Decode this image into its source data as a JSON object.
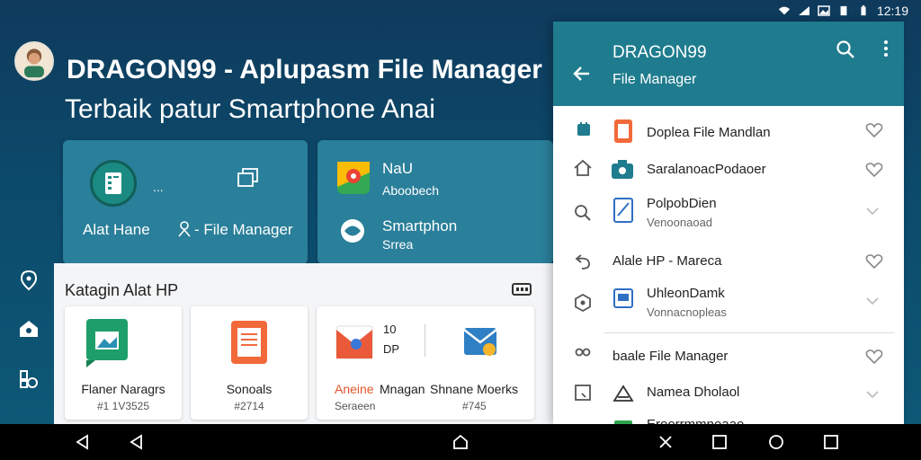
{
  "status_bar": {
    "time": "12:19",
    "icons": [
      "wifi-icon",
      "signal-icon",
      "image-icon",
      "sim-icon",
      "battery-icon"
    ]
  },
  "hero": {
    "title": "DRAGON99 - Aplupasm File Manager",
    "subtitle": "Terbaik patur Smartphone Anai"
  },
  "feature_cards": [
    {
      "label_left": "Alat Hane",
      "label_right": "- File Manager",
      "dots": "..."
    },
    {
      "item1_title": "NaU",
      "item1_sub": "Aboobech",
      "item2_title": "Smartphon",
      "item2_sub": "Srrea"
    }
  ],
  "left_rail": {
    "icons": [
      "location-pin-icon",
      "home-icon",
      "apps-icon"
    ]
  },
  "category_panel": {
    "title": "Katagin Alat HP",
    "cards": [
      {
        "title": "Flaner Naragrs",
        "num": "#1 1V3525"
      },
      {
        "title": "Sonoals",
        "num": "#2714"
      },
      {
        "title_a": "Aneine",
        "title_b": "Mnagan",
        "sub": "Seraeen",
        "num_left": "10",
        "num_left2": "DP",
        "title": "Shnane Moerks",
        "num": "#745"
      }
    ]
  },
  "drawer": {
    "title": "DRAGON99",
    "subtitle": "File Manager",
    "items": [
      {
        "label": "Doplea File Mandlan"
      },
      {
        "label": "SaralanoacPodaoer"
      },
      {
        "label": "PolpobDien",
        "sub": "Venoonaoad"
      },
      {
        "label": "Alale HP - Mareca"
      },
      {
        "label": "UhleonDamk",
        "sub": "Vonnacnopleas"
      },
      {
        "label": "baale File Manager"
      },
      {
        "label": "Namea Dholaol"
      },
      {
        "label": "Eroorrmmneaae"
      }
    ]
  },
  "colors": {
    "accent": "#1f7c8e",
    "background": "#0c4a6b",
    "card": "#2a7f9a"
  }
}
